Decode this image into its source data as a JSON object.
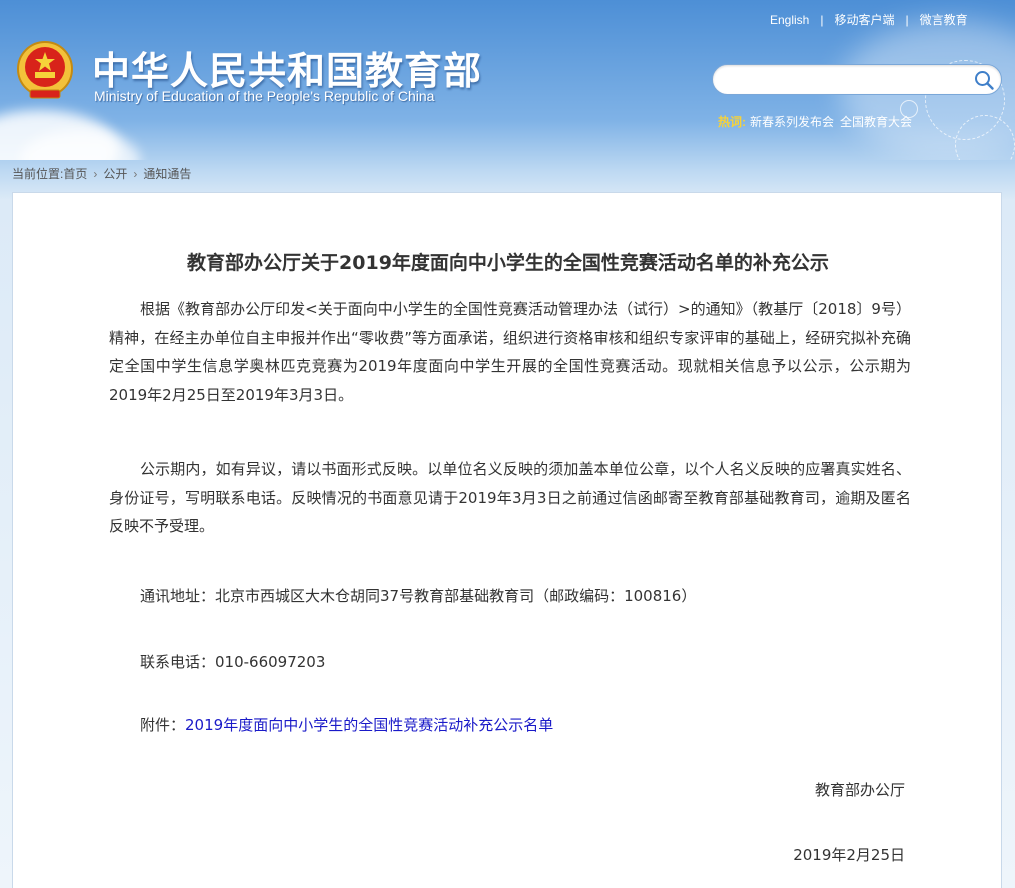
{
  "header": {
    "title_cn": "中华人民共和国教育部",
    "title_en": "Ministry of Education of the People's Republic of China",
    "top_links": [
      "English",
      "移动客户端",
      "微言教育"
    ],
    "search": {
      "placeholder": ""
    },
    "hot_label": "热词:",
    "hot_words": [
      "新春系列发布会",
      "全国教育大会"
    ]
  },
  "breadcrumb": {
    "prefix": "当前位置:",
    "items": [
      "首页",
      "公开",
      "通知通告"
    ]
  },
  "article": {
    "title": "教育部办公厅关于2019年度面向中小学生的全国性竞赛活动名单的补充公示",
    "paragraph1": "根据《教育部办公厅印发<关于面向中小学生的全国性竞赛活动管理办法（试行）>的通知》（教基厅〔2018〕9号）精神，在经主办单位自主申报并作出“零收费”等方面承诺，组织进行资格审核和组织专家评审的基础上，经研究拟补充确定全国中学生信息学奥林匹克竞赛为2019年度面向中学生开展的全国性竞赛活动。现就相关信息予以公示，公示期为2019年2月25日至2019年3月3日。",
    "paragraph2": "公示期内，如有异议，请以书面形式反映。以单位名义反映的须加盖本单位公章，以个人名义反映的应署真实姓名、身份证号，写明联系电话。反映情况的书面意见请于2019年3月3日之前通过信函邮寄至教育部基础教育司，逾期及匿名反映不予受理。",
    "address": "通讯地址：北京市西城区大木仓胡同37号教育部基础教育司（邮政编码：100816）",
    "phone": "联系电话：010-66097203",
    "attachment_label": "附件：",
    "attachment_link": "2019年度面向中小学生的全国性竞赛活动补充公示名单",
    "signature": "教育部办公厅",
    "date": "2019年2月25日"
  },
  "colors": {
    "sky_top": "#4d8fd6",
    "link_blue": "#1a1ac8",
    "hot_label": "#f6d23a"
  }
}
